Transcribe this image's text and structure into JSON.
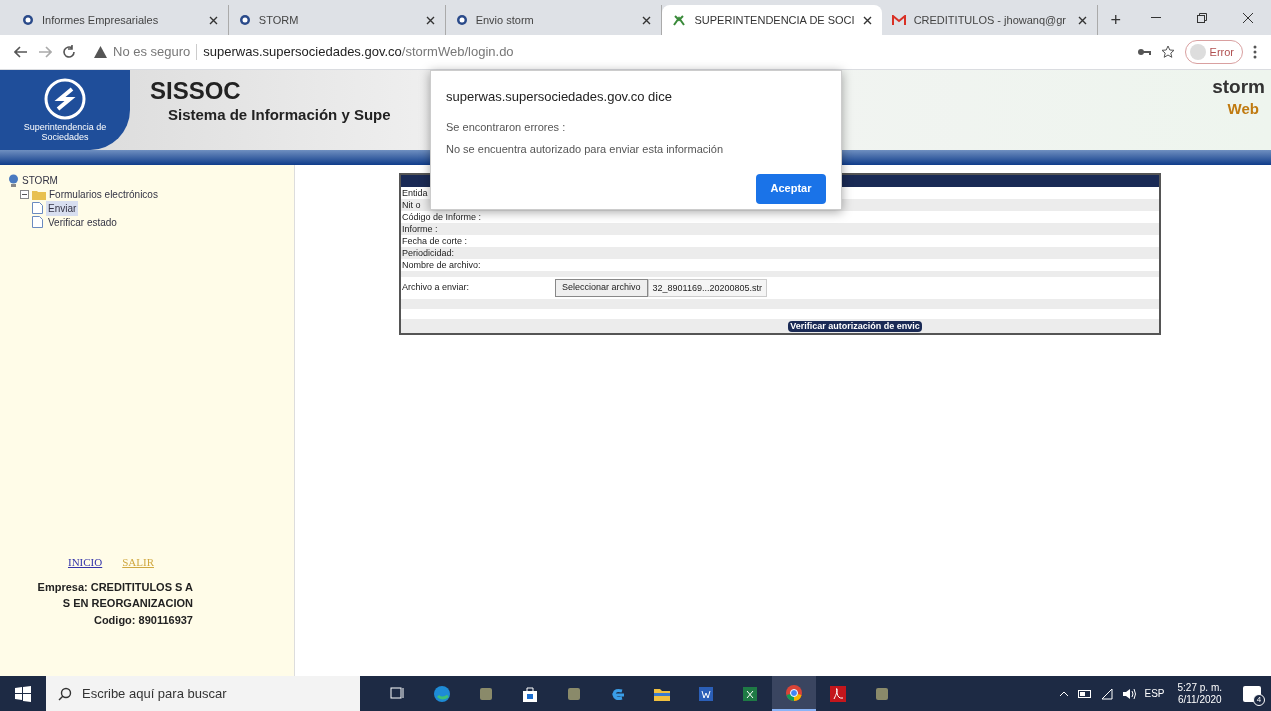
{
  "browser": {
    "tabs": [
      {
        "title": "Informes Empresariales",
        "kind": "globe",
        "selected": false
      },
      {
        "title": "STORM",
        "kind": "globe",
        "selected": false
      },
      {
        "title": "Envio storm",
        "kind": "globe",
        "selected": false
      },
      {
        "title": "SUPERINTENDENCIA DE SOCI",
        "kind": "leaf",
        "selected": true
      },
      {
        "title": "CREDITITULOS - jhowanq@gr",
        "kind": "mail",
        "selected": false
      }
    ],
    "new_tab": "+",
    "security": "No es seguro",
    "url_host": "superwas.supersociedades.gov.co",
    "url_path": "/stormWeb/login.do",
    "profile": "Error"
  },
  "header": {
    "logo_text": "Superintendencia de Sociedades",
    "title": "SISSOC",
    "subtitle": "Sistema de Información y Supe",
    "brand_top": "storm",
    "brand_bottom": "Web"
  },
  "tree": [
    {
      "label": "STORM",
      "children": [
        {
          "label": "Formularios electrónicos",
          "expanded": true,
          "children": [
            {
              "label": "Enviar",
              "selected": true
            },
            {
              "label": "Verificar estado",
              "selected": false
            }
          ]
        }
      ]
    }
  ],
  "sidebar_links": [
    "INICIO",
    "SALIR"
  ],
  "company": [
    "Empresa: CREDITITULOS S A",
    "S EN REORGANIZACION",
    "Codigo: 890116937"
  ],
  "form": {
    "rows": [
      "Entida",
      "Nit o",
      "Código de Informe :",
      "Informe :",
      "Fecha de corte :",
      "Periodicidad:",
      "Nombre de archivo:"
    ],
    "file_label": "Archivo a enviar:",
    "file_button": "Seleccionar archivo",
    "file_name": "32_8901169...20200805.str",
    "submit": "Verificar autorización de envic"
  },
  "dialog": {
    "title": "superwas.supersociedades.gov.co dice",
    "lines": [
      "Se encontraron errores :",
      "No se encuentra autorizado para enviar esta información"
    ],
    "button": "Aceptar"
  },
  "taskbar": {
    "search_placeholder": "Escribe aquí para buscar",
    "apps": [
      {
        "kind": "taskview",
        "active": false
      },
      {
        "kind": "edge",
        "active": false
      },
      {
        "kind": "tool",
        "active": false
      },
      {
        "kind": "store",
        "active": false
      },
      {
        "kind": "tool",
        "active": false
      },
      {
        "kind": "ie",
        "active": false
      },
      {
        "kind": "folder",
        "active": false
      },
      {
        "kind": "word",
        "active": false
      },
      {
        "kind": "excel",
        "active": false
      },
      {
        "kind": "chrome",
        "active": true
      },
      {
        "kind": "acrobat",
        "active": false
      },
      {
        "kind": "tool",
        "active": false
      }
    ],
    "language": "ESP",
    "time": "5:27 p. m.",
    "date": "6/11/2020",
    "notifications": "4"
  }
}
